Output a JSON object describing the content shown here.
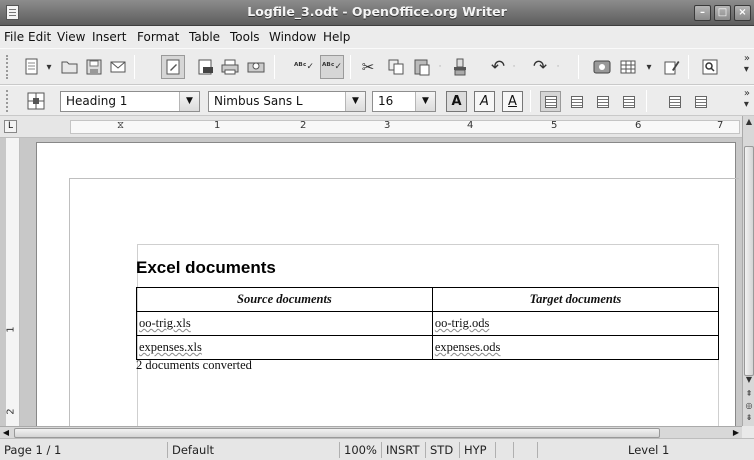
{
  "window": {
    "title": "Logfile_3.odt - OpenOffice.org Writer"
  },
  "menu": {
    "file": "File",
    "edit": "Edit",
    "view": "View",
    "insert": "Insert",
    "format": "Format",
    "table": "Table",
    "tools": "Tools",
    "window": "Window",
    "help": "Help"
  },
  "formatting": {
    "style": "Heading 1",
    "font": "Nimbus Sans L",
    "size": "16",
    "bold": "A",
    "italic": "A",
    "underline": "A"
  },
  "ruler": {
    "marks": [
      "1",
      "2",
      "3",
      "4",
      "5",
      "6",
      "7"
    ]
  },
  "vruler": {
    "marks": [
      "1",
      "2"
    ]
  },
  "document": {
    "heading": "Excel documents",
    "table": {
      "headers": [
        "Source documents",
        "Target documents"
      ],
      "rows": [
        [
          "oo-trig.xls",
          "oo-trig.ods"
        ],
        [
          "expenses.xls",
          "expenses.ods"
        ]
      ]
    },
    "summary": "2 documents converted"
  },
  "status": {
    "page": "Page 1 / 1",
    "style": "Default",
    "zoom": "100%",
    "insert_mode": "INSRT",
    "selection_mode": "STD",
    "hyphenation": "HYP",
    "outline_level": "Level 1"
  }
}
